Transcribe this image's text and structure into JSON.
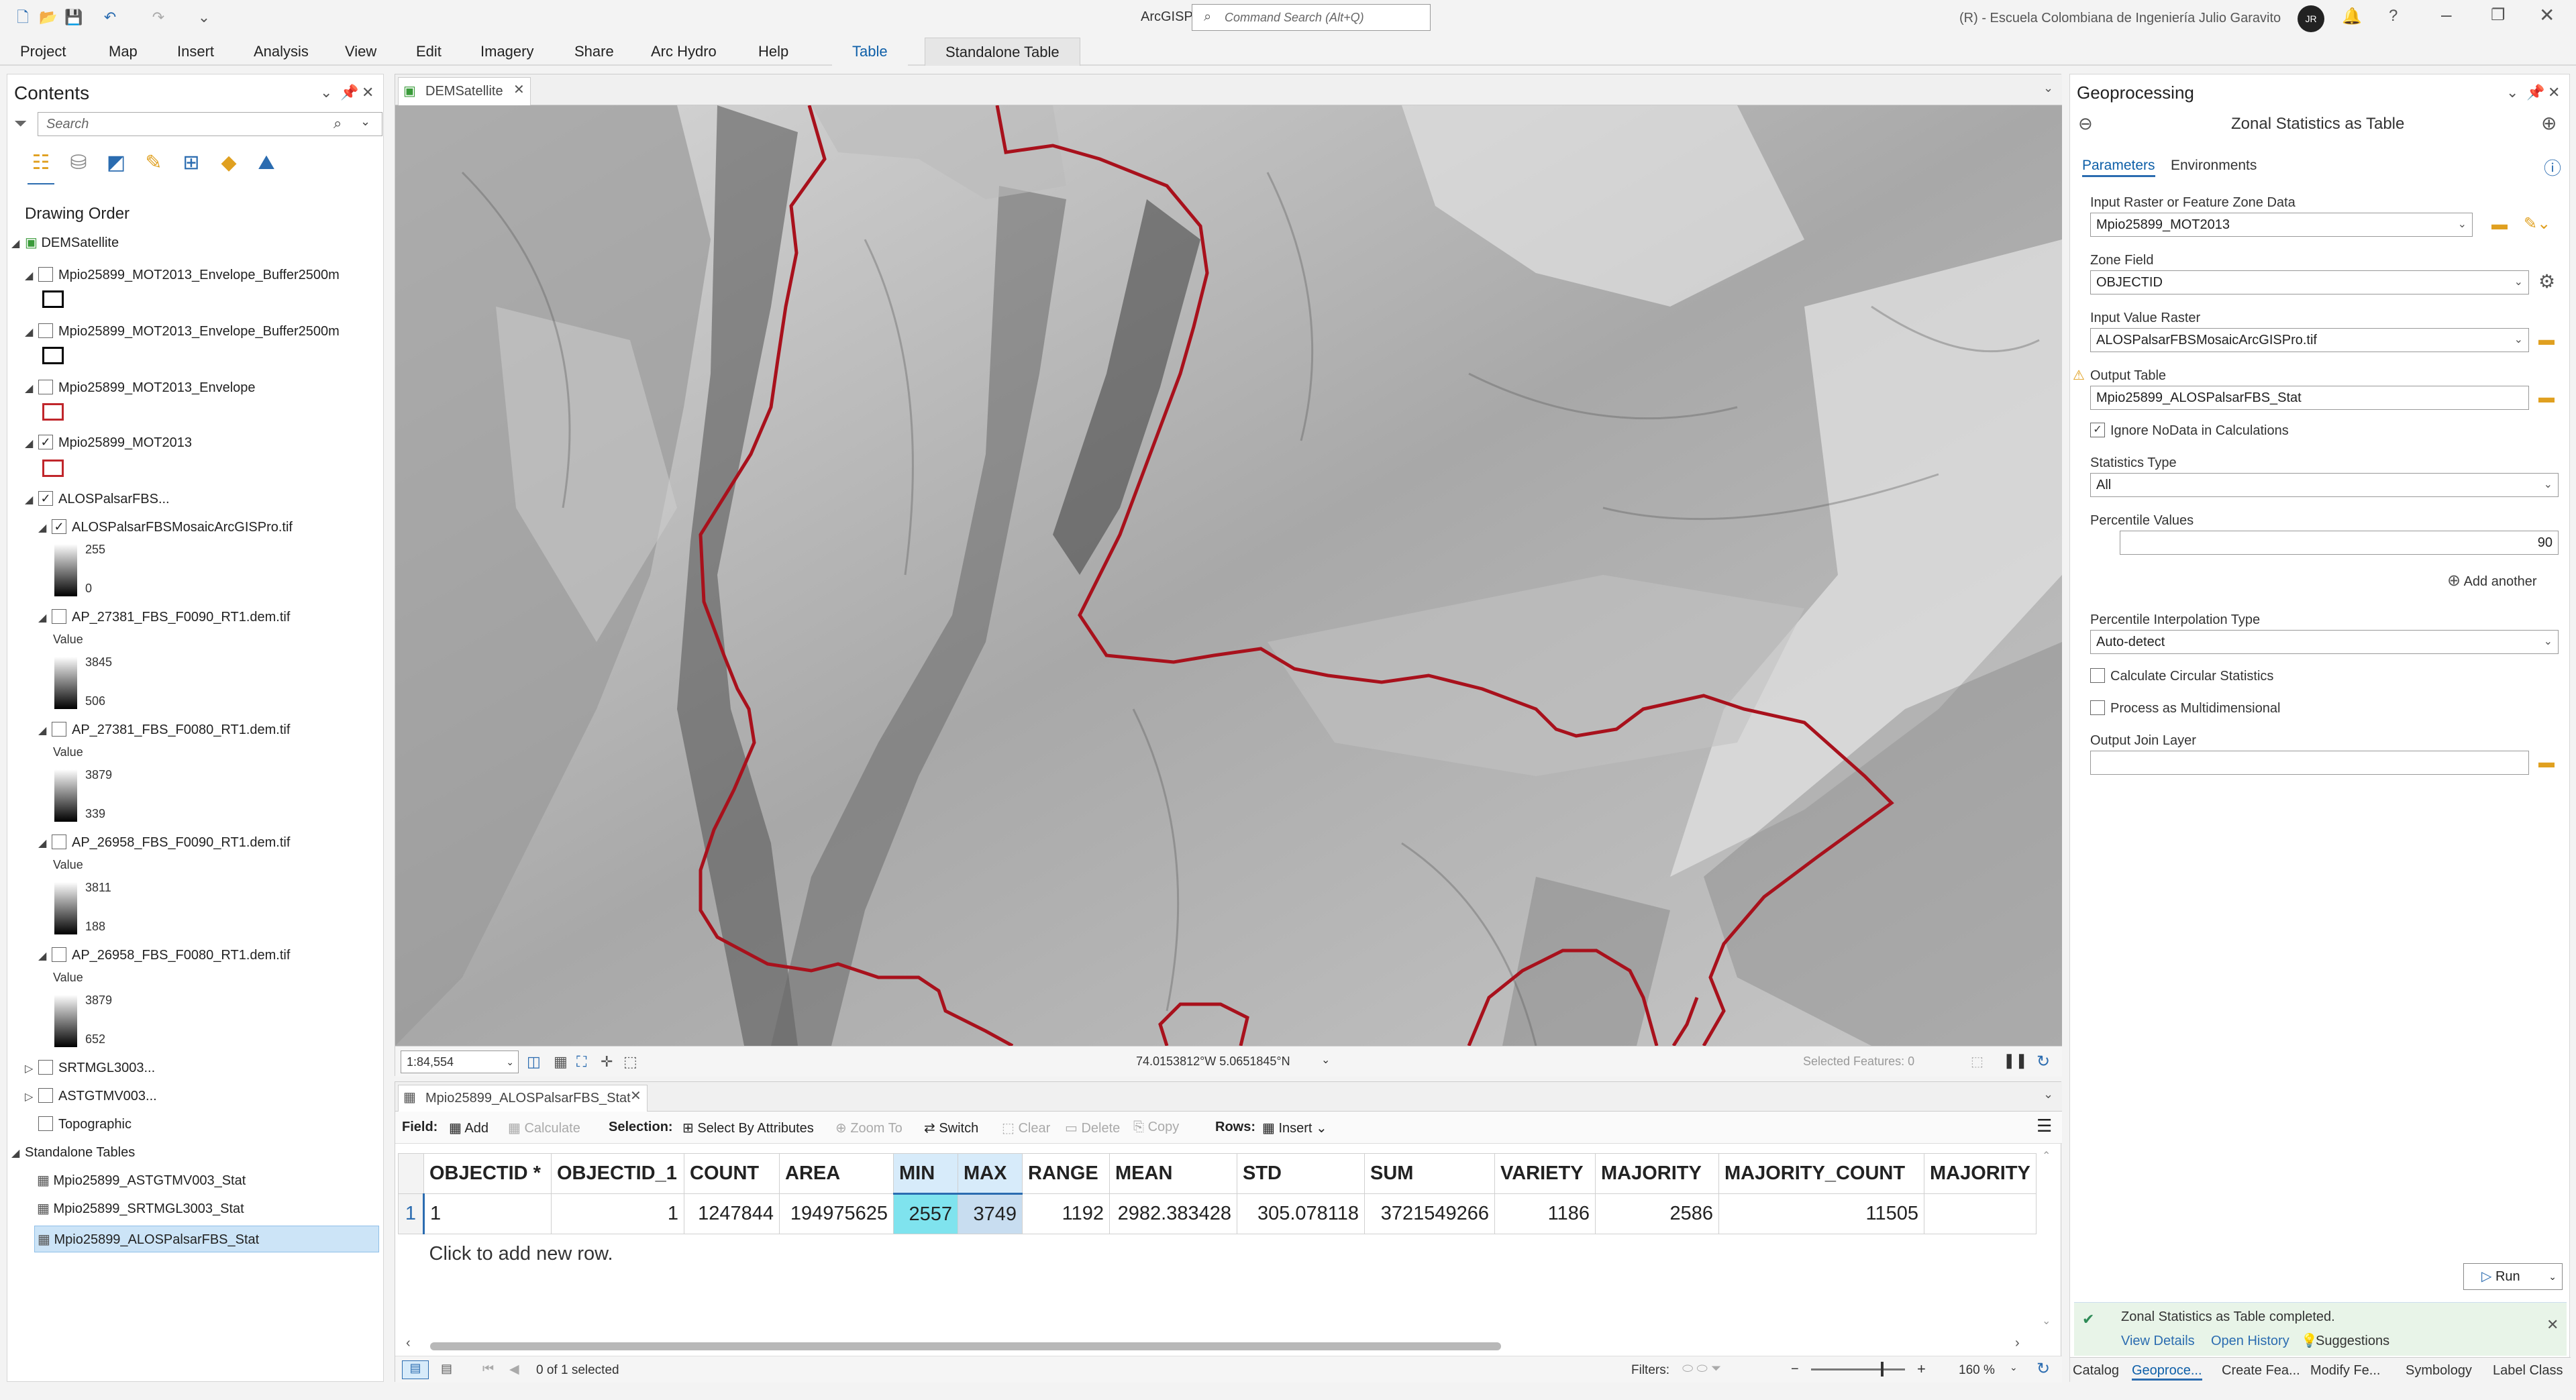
{
  "app_title": "ArcGISPro",
  "command_search_placeholder": "Command Search (Alt+Q)",
  "account": "(R) - Escuela Colombiana de Ingeniería Julio Garavito",
  "avatar_initials": "JR",
  "ribbon_tabs": [
    "Project",
    "Map",
    "Insert",
    "Analysis",
    "View",
    "Edit",
    "Imagery",
    "Share",
    "Arc Hydro",
    "Help",
    "Table",
    "Standalone Table"
  ],
  "contents": {
    "title": "Contents",
    "search_placeholder": "Search",
    "drawing_order": "Drawing Order",
    "map_name": "DEMSatellite",
    "layers": [
      {
        "name": "Mpio25899_MOT2013_Envelope_Buffer2500m",
        "checked": false
      },
      {
        "name": "Mpio25899_MOT2013_Envelope_Buffer2500m",
        "checked": false
      },
      {
        "name": "Mpio25899_MOT2013_Envelope",
        "checked": false
      },
      {
        "name": "Mpio25899_MOT2013",
        "checked": true
      },
      {
        "name": "ALOSPalsarFBS...",
        "checked": true
      },
      {
        "name": "ALOSPalsarFBSMosaicArcGISPro.tif",
        "checked": true,
        "high": "255",
        "low": "0"
      },
      {
        "name": "AP_27381_FBS_F0090_RT1.dem.tif",
        "checked": false,
        "value_label": "Value",
        "high": "3845",
        "low": "506"
      },
      {
        "name": "AP_27381_FBS_F0080_RT1.dem.tif",
        "checked": false,
        "value_label": "Value",
        "high": "3879",
        "low": "339"
      },
      {
        "name": "AP_26958_FBS_F0090_RT1.dem.tif",
        "checked": false,
        "value_label": "Value",
        "high": "3811",
        "low": "188"
      },
      {
        "name": "AP_26958_FBS_F0080_RT1.dem.tif",
        "checked": false,
        "value_label": "Value",
        "high": "3879",
        "low": "652"
      },
      {
        "name": "SRTMGL3003...",
        "checked": false
      },
      {
        "name": "ASTGTMV003...",
        "checked": false
      },
      {
        "name": "Topographic",
        "checked": false
      }
    ],
    "standalone_header": "Standalone Tables",
    "standalone_tables": [
      "Mpio25899_ASTGTMV003_Stat",
      "Mpio25899_SRTMGL3003_Stat",
      "Mpio25899_ALOSPalsarFBS_Stat"
    ]
  },
  "map": {
    "tab": "DEMSatellite",
    "scale": "1:84,554",
    "coords": "74.0153812°W 5.0651845°N",
    "selected_features": "Selected Features: 0"
  },
  "attr": {
    "tab": "Mpio25899_ALOSPalsarFBS_Stat",
    "field_label": "Field:",
    "add": "Add",
    "calculate": "Calculate",
    "selection_label": "Selection:",
    "select_by_attr": "Select By Attributes",
    "zoom_to": "Zoom To",
    "switch": "Switch",
    "clear": "Clear",
    "delete": "Delete",
    "copy": "Copy",
    "rows_label": "Rows:",
    "insert": "Insert",
    "columns": [
      "OBJECTID *",
      "OBJECTID_1",
      "COUNT",
      "AREA",
      "MIN",
      "MAX",
      "RANGE",
      "MEAN",
      "STD",
      "SUM",
      "VARIETY",
      "MAJORITY",
      "MAJORITY_COUNT",
      "MAJORITY"
    ],
    "row_num": "1",
    "row": [
      "1",
      "1",
      "1247844",
      "194975625",
      "2557",
      "3749",
      "1192",
      "2982.383428",
      "305.078118",
      "3721549266",
      "1186",
      "2586",
      "11505",
      ""
    ],
    "add_row": "Click to add new row.",
    "selected": "0 of 1 selected",
    "filters": "Filters:",
    "zoom": "160 %"
  },
  "gp": {
    "title": "Geoprocessing",
    "tool": "Zonal Statistics as Table",
    "tab_params": "Parameters",
    "tab_env": "Environments",
    "l_zone_data": "Input Raster or Feature Zone Data",
    "v_zone_data": "Mpio25899_MOT2013",
    "l_zone_field": "Zone Field",
    "v_zone_field": "OBJECTID",
    "l_value_raster": "Input Value Raster",
    "v_value_raster": "ALOSPalsarFBSMosaicArcGISPro.tif",
    "l_output": "Output Table",
    "v_output": "Mpio25899_ALOSPalsarFBS_Stat",
    "ignore_nodata": "Ignore NoData in Calculations",
    "l_stat_type": "Statistics Type",
    "v_stat_type": "All",
    "l_percentile": "Percentile Values",
    "v_percentile": "90",
    "add_another": "Add another",
    "l_interp": "Percentile Interpolation Type",
    "v_interp": "Auto-detect",
    "circular": "Calculate Circular Statistics",
    "multidim": "Process as Multidimensional",
    "l_join": "Output Join Layer",
    "run": "Run",
    "status": "Zonal Statistics as Table completed.",
    "view_details": "View Details",
    "open_history": "Open History",
    "suggestions": "Suggestions",
    "bottom_tabs": [
      "Catalog",
      "Geoproce...",
      "Create Fea...",
      "Modify Fe...",
      "Symbology",
      "Label Class"
    ]
  }
}
